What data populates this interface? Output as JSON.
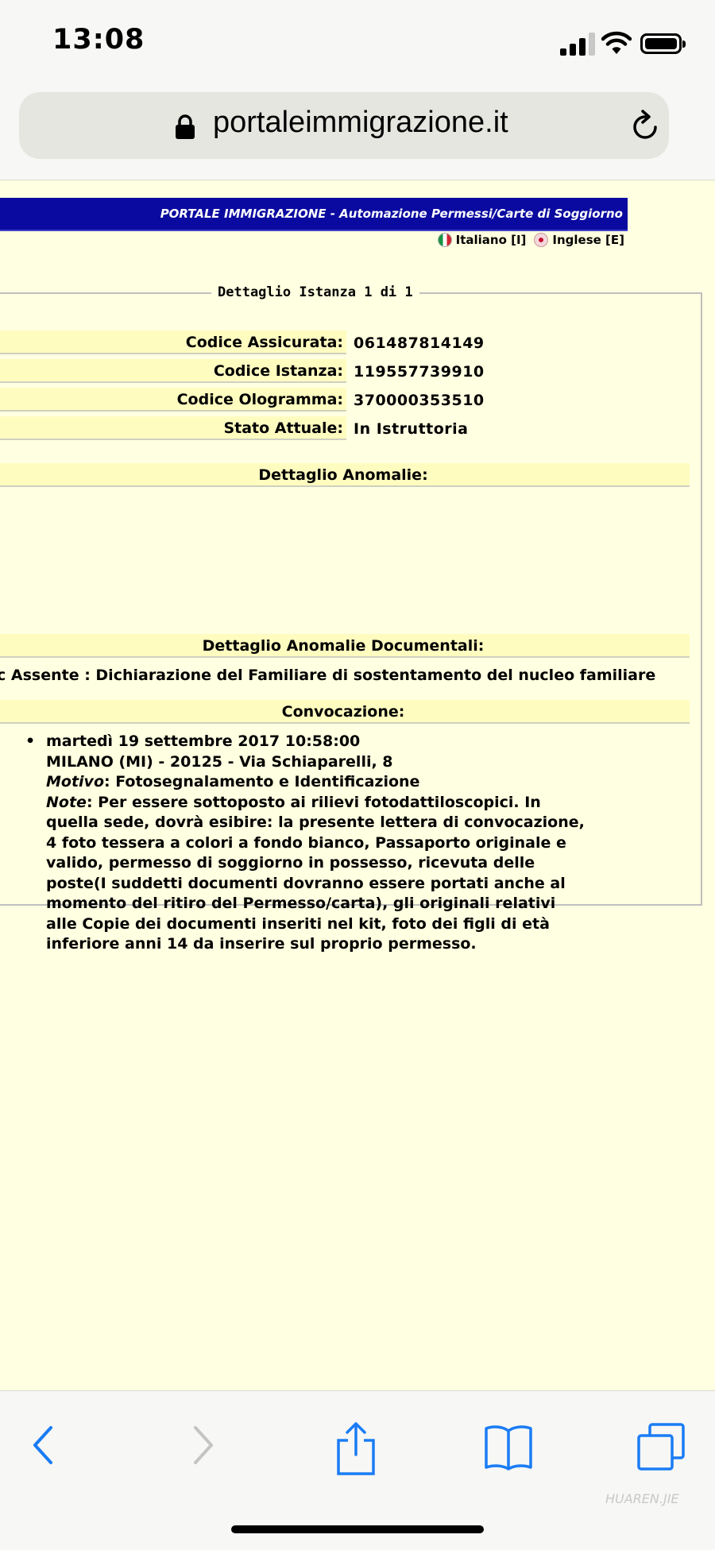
{
  "status_bar": {
    "time": "13:08"
  },
  "browser": {
    "url": "portaleimmigrazione.it"
  },
  "portal": {
    "banner": "PORTALE IMMIGRAZIONE - Automazione Permessi/Carte di Soggiorno",
    "languages": [
      {
        "label": "Italiano [I]"
      },
      {
        "label": "Inglese [E]"
      }
    ]
  },
  "detail": {
    "legend": "Dettaglio Istanza 1 di 1",
    "fields": [
      {
        "label": "Codice Assicurata:",
        "value": "061487814149"
      },
      {
        "label": "Codice Istanza:",
        "value": "119557739910"
      },
      {
        "label": "Codice Ologramma:",
        "value": "370000353510"
      },
      {
        "label": "Stato Attuale:",
        "value": "In Istruttoria"
      }
    ],
    "anomalie_header": "Dettaglio Anomalie:",
    "anomalie_doc_header": "Dettaglio Anomalie Documentali:",
    "anomalie_doc_text": "c Assente : Dichiarazione del Familiare di sostentamento del nucleo familiare",
    "convocazione_header": "Convocazione:",
    "convocazione": {
      "datetime": "martedì 19 settembre 2017 10:58:00",
      "address": "MILANO (MI) - 20125 - Via Schiaparelli, 8",
      "motivo_label": "Motivo",
      "motivo_value": ": Fotosegnalamento e Identificazione",
      "note_label": "Note",
      "note_lines": [
        ": Per essere sottoposto ai rilievi fotodattiloscopici. In",
        "quella sede, dovrà esibire: la presente lettera di convocazione,",
        "4 foto tessera a colori a fondo bianco, Passaporto originale e",
        "valido, permesso di soggiorno in possesso, ricevuta delle",
        "poste(I suddetti documenti dovranno essere portati anche al",
        "momento del ritiro del Permesso/carta), gli originali relativi",
        "alle Copie dei documenti inseriti nel kit, foto dei figli di età",
        "inferiore anni 14 da inserire sul proprio permesso."
      ]
    }
  },
  "watermark": "HUAREN.JIE",
  "colors": {
    "banner": "#0a0aa0",
    "page_bg": "#ffffe1",
    "header_bg": "#fffcc0",
    "ios_blue": "#1a7cf5"
  }
}
